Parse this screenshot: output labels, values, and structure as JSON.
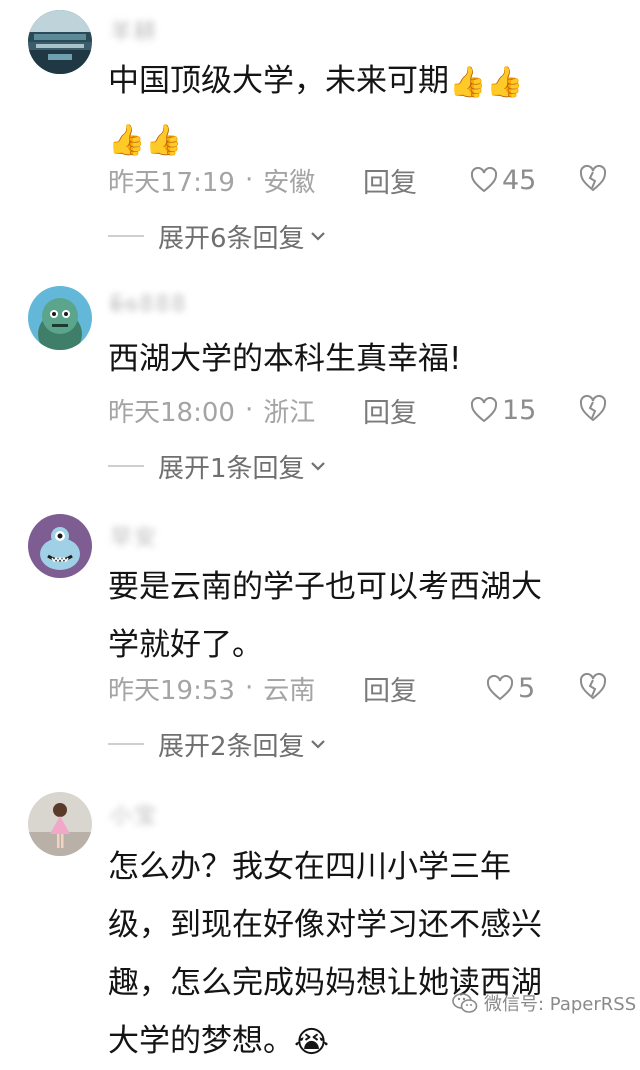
{
  "comments": [
    {
      "username": "羊耕",
      "text_lines": [
        "中国顶级大学，未来可期"
      ],
      "emojis_line1": "👍👍",
      "emojis_line2": "👍👍",
      "time": "昨天17:19",
      "location": "安徽",
      "reply_label": "回复",
      "likes": "45",
      "expand_label": "展开6条回复"
    },
    {
      "username": "E̶s̶888",
      "text_lines": [
        "西湖大学的本科生真幸福!"
      ],
      "time": "昨天18:00",
      "location": "浙江",
      "reply_label": "回复",
      "likes": "15",
      "expand_label": "展开1条回复"
    },
    {
      "username": "早安",
      "text_lines": [
        "要是云南的学子也可以考西湖大",
        "学就好了。"
      ],
      "time": "昨天19:53",
      "location": "云南",
      "reply_label": "回复",
      "likes": "5",
      "expand_label": "展开2条回复"
    },
    {
      "username": "小宝",
      "text_lines": [
        "怎么办？我女在四川小学三年",
        "级，到现在好像对学习还不感兴",
        "趣，怎么完成妈妈想让她读西湖",
        "大学的梦想。"
      ],
      "emoji_end": "😭"
    }
  ],
  "watermark": "微信号: PaperRSS",
  "icons": {
    "like": "heart-outline-icon",
    "dislike": "broken-heart-icon",
    "expand": "chevron-down-icon",
    "wechat": "wechat-icon"
  },
  "colors": {
    "meta_text": "#a4a4a4",
    "body_text": "#141414"
  }
}
